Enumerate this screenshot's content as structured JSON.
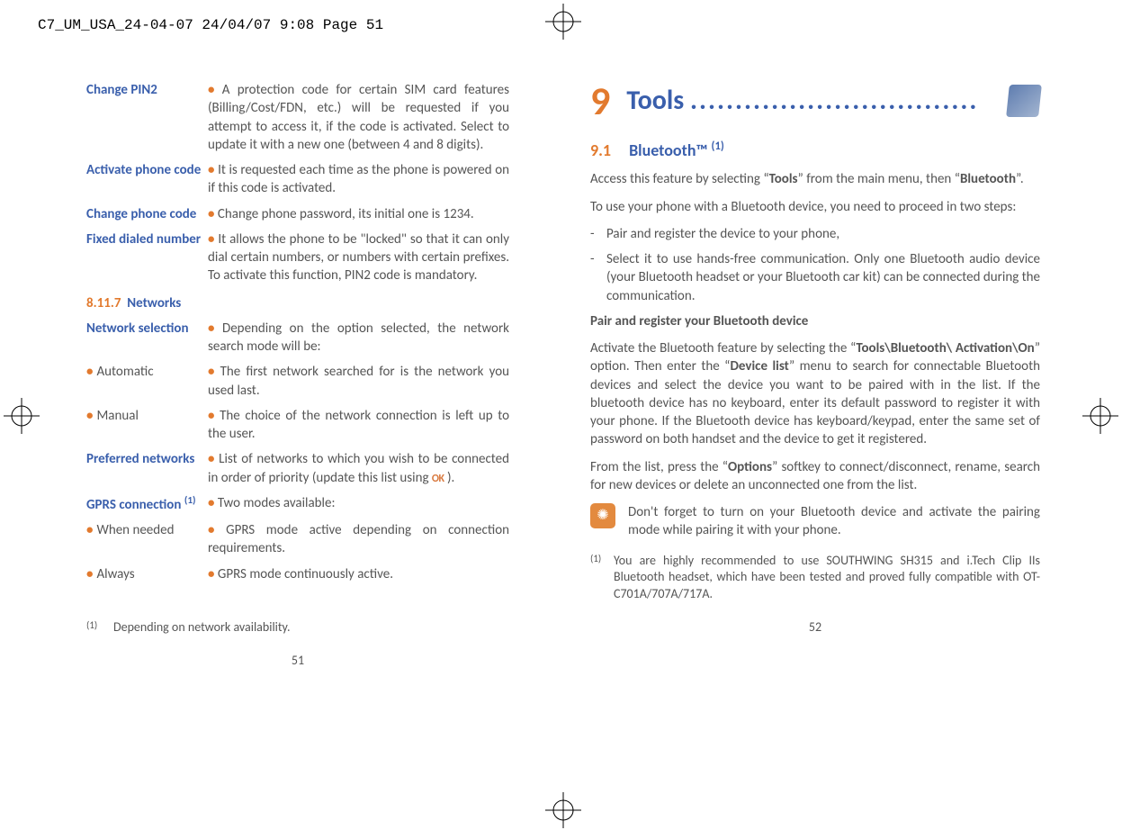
{
  "print_header": "C7_UM_USA_24-04-07  24/04/07  9:08  Page 51",
  "left": {
    "rows": [
      {
        "label": "Change PIN2",
        "desc": "A protection code for certain SIM card features (Billing/Cost/FDN, etc.) will be requested if you attempt to access it, if the code is activated. Select to update it with a new one (between 4 and 8 digits)."
      },
      {
        "label": "Activate phone code",
        "desc": "It is requested each time as the phone is powered on if this code is activated."
      },
      {
        "label": "Change phone code",
        "desc": "Change phone password, its initial one is 1234."
      },
      {
        "label": "Fixed dialed number",
        "desc": "It allows the phone to be \"locked\" so that it can only dial certain numbers, or numbers with certain prefixes. To activate this function, PIN2 code is mandatory."
      }
    ],
    "section_num": "8.11.7",
    "section_title": "Networks",
    "net_rows": [
      {
        "kind": "main",
        "label": "Network selection",
        "desc": "Depending on the option selected, the network search mode will be:"
      },
      {
        "kind": "sub",
        "label": "Automatic",
        "desc": "The first network searched for is the network you used last."
      },
      {
        "kind": "sub",
        "label": "Manual",
        "desc": "The choice of the network connection is left up to the user."
      },
      {
        "kind": "main",
        "label": "Preferred networks",
        "desc_pre": "List of networks to which you wish to be connected in order of priority (update this list using ",
        "desc_post": " )."
      },
      {
        "kind": "main",
        "label": "GPRS connection",
        "sup": "(1)",
        "desc": "Two modes available:"
      },
      {
        "kind": "sub",
        "label": "When needed",
        "desc": "GPRS mode active depending on connection requirements."
      },
      {
        "kind": "sub",
        "label": "Always",
        "desc": "GPRS mode continuously active."
      }
    ],
    "footnote_mark": "(1)",
    "footnote_text": "Depending on network availability.",
    "pagenum": "51"
  },
  "right": {
    "chapter_num": "9",
    "chapter_title": "Tools",
    "dots": "................................",
    "sec_num": "9.1",
    "sec_title": "Bluetooth™",
    "sec_sup": "(1)",
    "para1_pre": "Access this feature by selecting “",
    "para1_b1": "Tools",
    "para1_mid": "” from the main menu, then “",
    "para1_b2": "Bluetooth",
    "para1_post": "”.",
    "para2": "To use your phone with a Bluetooth device, you need to proceed in two steps:",
    "steps": [
      "Pair and register the device to your phone,",
      "Select it to use hands-free communication. Only one Bluetooth audio device (your Bluetooth headset or your Bluetooth car kit) can be connected during the communication."
    ],
    "subhead": "Pair and register your Bluetooth device",
    "para3_pre": "Activate the Bluetooth feature by selecting the “",
    "para3_b1": "Tools\\Bluetooth\\ Activation\\On",
    "para3_mid1": "” option. Then enter the “",
    "para3_b2": "Device list",
    "para3_post": "” menu to search for connectable Bluetooth devices and select the device you want to be paired with in the list. If the bluetooth device has no keyboard, enter its default password to register it with your phone. If the Bluetooth device has keyboard/keypad, enter the same set of password on both handset and the device to get it registered.",
    "para4_pre": "From the list, press the “",
    "para4_b1": "Options",
    "para4_post": "” softkey to connect/disconnect, rename, search for new devices or delete an unconnected one from the list.",
    "callout": "Don't forget to turn on your Bluetooth device and activate the pairing mode while pairing it with your phone.",
    "footnote_mark": "(1)",
    "footnote_text": "You are highly recommended to use SOUTHWING SH315 and i.Tech Clip IIs Bluetooth headset, which have been tested and proved fully compatible with OT-C701A/707A/717A.",
    "pagenum": "52"
  }
}
